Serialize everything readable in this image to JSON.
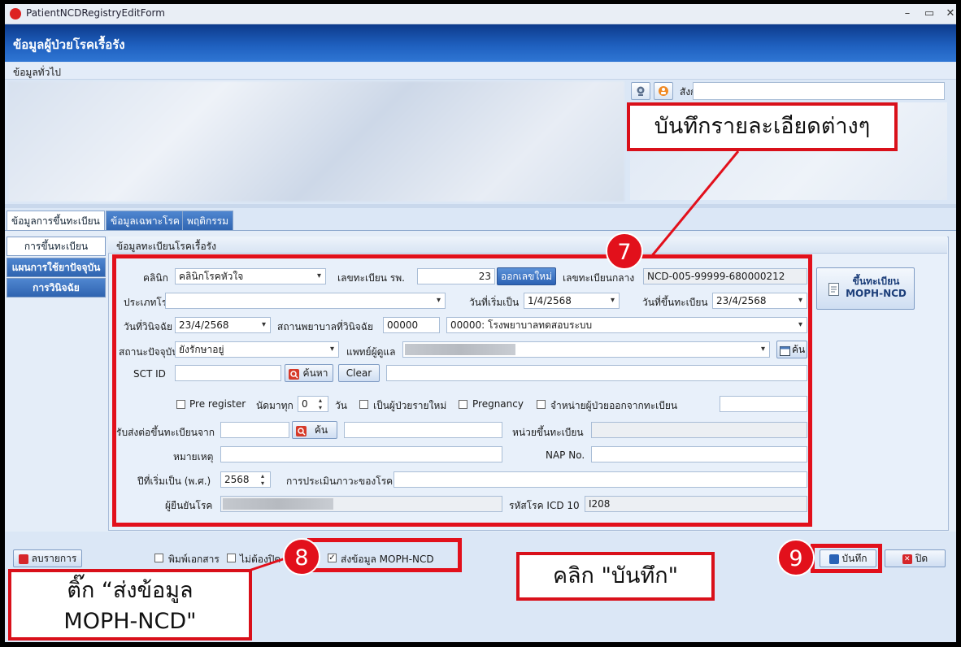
{
  "window": {
    "title": "PatientNCDRegistryEditForm",
    "min": "–",
    "max": "▭",
    "close": "✕"
  },
  "header": {
    "title": "ข้อมูลผู้ป่วยโรคเรื้อรัง"
  },
  "general": {
    "section": "ข้อมูลทั่วไป",
    "sangkat_label": "สังกัด",
    "sangkat_value": ""
  },
  "tabs": [
    {
      "label": "ข้อมูลการขึ้นทะเบียน"
    },
    {
      "label": "ข้อมูลเฉพาะโรค"
    },
    {
      "label": "พฤติกรรม"
    }
  ],
  "nav": [
    {
      "label": "การขึ้นทะเบียน"
    },
    {
      "label": "แผนการใช้ยาปัจจุบัน"
    },
    {
      "label": "การวินิจฉัย"
    }
  ],
  "form": {
    "group_title": "ข้อมูลทะเบียนโรคเรื้อรัง",
    "clinic_label": "คลินิก",
    "clinic_value": "คลินิกโรคหัวใจ",
    "hosp_reg_label": "เลขทะเบียน รพ.",
    "hosp_reg_value": "23",
    "new_number_button": "ออกเลขใหม่",
    "central_reg_label": "เลขทะเบียนกลาง",
    "central_reg_value": "NCD-005-99999-680000212",
    "disease_type_label": "ประเภทโรค",
    "disease_type_value": "",
    "start_date_label": "วันที่เริ่มเป็น",
    "start_date_value": "1/4/2568",
    "reg_date_label": "วันที่ขึ้นทะเบียน",
    "reg_date_value": "23/4/2568",
    "diag_date_label": "วันที่วินิจฉัย",
    "diag_date_value": "23/4/2568",
    "diag_hosp_label": "สถานพยาบาลที่วินิจฉัย",
    "diag_hosp_code": "00000",
    "diag_hosp_value": "00000: โรงพยาบาลทดสอบระบบ",
    "status_label": "สถานะปัจจุบัน",
    "status_value": "ยังรักษาอยู่",
    "doctor_label": "แพทย์ผู้ดูแล",
    "doctor_search_button": "ค้น",
    "sct_label": "SCT ID",
    "sct_value": "",
    "search_button": "ค้นหา",
    "clear_button": "Clear",
    "pre_register_label": "Pre register",
    "appoint_every_label": "นัดมาทุก",
    "appoint_every_value": "0",
    "day_label": "วัน",
    "new_patient_label": "เป็นผู้ป่วยรายใหม่",
    "pregnancy_label": "Pregnancy",
    "discharge_label": "จำหน่ายผู้ป่วยออกจากทะเบียน",
    "referral_label": "รับส่งต่อขึ้นทะเบียนจาก",
    "referral_search_button": "ค้น",
    "reg_unit_label": "หน่วยขึ้นทะเบียน",
    "note_label": "หมายเหตุ",
    "nap_label": "NAP No.",
    "start_year_label": "ปีที่เริ่มเป็น (พ.ศ.)",
    "start_year_value": "2568",
    "severity_label": "การประเมินภาวะของโรค",
    "confirmer_label": "ผู้ยืนยันโรค",
    "icd_label": "รหัสโรค ICD 10",
    "icd_value": "I208"
  },
  "moph_button": {
    "line1": "ขึ้นทะเบียน",
    "line2": "MOPH-NCD"
  },
  "bottom": {
    "delete_button": "ลบรายการ",
    "print_label": "พิมพ์เอกสาร",
    "no_close_label": "ไม่ต้องปิด",
    "send_moph_label": "ส่งข้อมูล MOPH-NCD",
    "save_button": "บันทึก",
    "close_button": "ปิด"
  },
  "annotations": {
    "callout7": "บันทึกรายละเอียดต่างๆ",
    "badge7": "7",
    "callout8_line1": "ติ๊ก “ส่งข้อมูล",
    "callout8_line2": "MOPH-NCD\"",
    "badge8": "8",
    "callout9": "คลิก \"บันทึก\"",
    "badge9": "9"
  },
  "colors": {
    "header": "#1e5fbe",
    "annotation_red": "#e2101b",
    "tab_blue": "#2f64b0"
  }
}
